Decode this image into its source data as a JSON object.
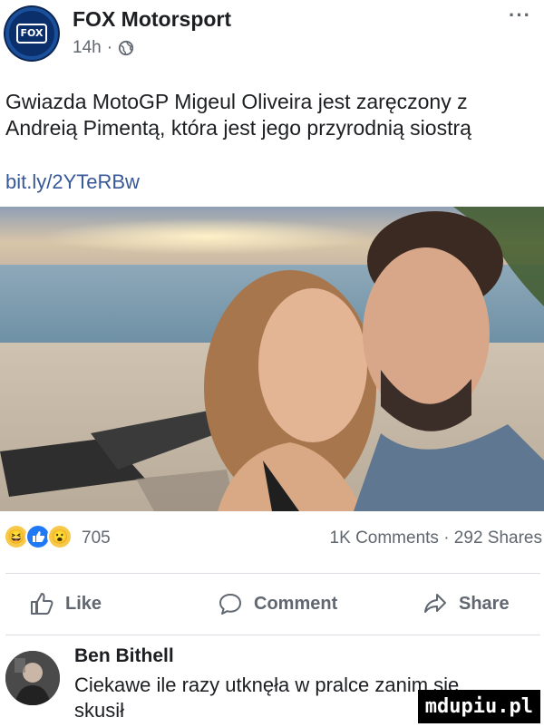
{
  "header": {
    "page_name": "FOX Motorsport",
    "avatar_label": "FOX",
    "time": "14h",
    "separator": "·",
    "more": "···"
  },
  "post": {
    "text": "Gwiazda MotoGP Migeul Oliveira jest zaręczony z Andreią Pimentą, która jest jego przyrodnią siostrą",
    "link": "bit.ly/2YTeRBw"
  },
  "stats": {
    "reaction_count": "705",
    "comments_shares": "1K Comments · 292 Shares"
  },
  "actions": {
    "like": "Like",
    "comment": "Comment",
    "share": "Share"
  },
  "comment": {
    "author": "Ben Bithell",
    "text": "Ciekawe ile razy utknęła w pralce zanim się skusił"
  },
  "watermark": "mdupiu.pl",
  "colors": {
    "link": "#385898",
    "secondary_text": "#606770",
    "brand_blue": "#0a2f6b"
  },
  "icons": [
    "fox-logo",
    "globe-icon",
    "more-icon",
    "haha-reaction-icon",
    "like-reaction-icon",
    "wow-reaction-icon",
    "like-icon",
    "comment-icon",
    "share-icon"
  ]
}
